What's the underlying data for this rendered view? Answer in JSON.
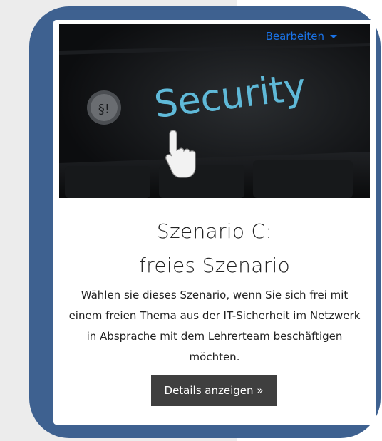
{
  "card": {
    "edit_label": "Bearbeiten",
    "image": {
      "word": "Security",
      "key_glyph": "§!",
      "icon": "cursor-hand-icon"
    },
    "title_line1": "Szenario C:",
    "title_line2": "freies Szenario",
    "description": "Wählen sie dieses Szenario, wenn Sie sich frei mit einem freien Thema aus der IT-Sicherheit im Netzwerk in Absprache mit dem Lehrerteam beschäftigen möchten.",
    "button_label": "Details anzeigen »"
  },
  "colors": {
    "frame": "#3e6190",
    "accent": "#1a73e8",
    "button_bg": "#3f3f3f"
  }
}
